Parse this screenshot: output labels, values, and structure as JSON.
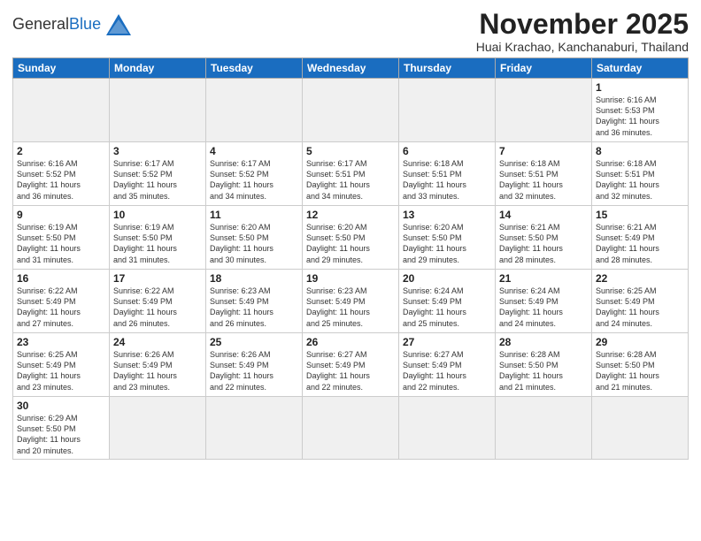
{
  "header": {
    "logo_general": "General",
    "logo_blue": "Blue",
    "month_title": "November 2025",
    "location": "Huai Krachao, Kanchanaburi, Thailand"
  },
  "weekdays": [
    "Sunday",
    "Monday",
    "Tuesday",
    "Wednesday",
    "Thursday",
    "Friday",
    "Saturday"
  ],
  "days": [
    {
      "num": "",
      "info": "",
      "empty": true
    },
    {
      "num": "",
      "info": "",
      "empty": true
    },
    {
      "num": "",
      "info": "",
      "empty": true
    },
    {
      "num": "",
      "info": "",
      "empty": true
    },
    {
      "num": "",
      "info": "",
      "empty": true
    },
    {
      "num": "",
      "info": "",
      "empty": true
    },
    {
      "num": "1",
      "info": "Sunrise: 6:16 AM\nSunset: 5:53 PM\nDaylight: 11 hours\nand 36 minutes."
    },
    {
      "num": "2",
      "info": "Sunrise: 6:16 AM\nSunset: 5:52 PM\nDaylight: 11 hours\nand 36 minutes."
    },
    {
      "num": "3",
      "info": "Sunrise: 6:17 AM\nSunset: 5:52 PM\nDaylight: 11 hours\nand 35 minutes."
    },
    {
      "num": "4",
      "info": "Sunrise: 6:17 AM\nSunset: 5:52 PM\nDaylight: 11 hours\nand 34 minutes."
    },
    {
      "num": "5",
      "info": "Sunrise: 6:17 AM\nSunset: 5:51 PM\nDaylight: 11 hours\nand 34 minutes."
    },
    {
      "num": "6",
      "info": "Sunrise: 6:18 AM\nSunset: 5:51 PM\nDaylight: 11 hours\nand 33 minutes."
    },
    {
      "num": "7",
      "info": "Sunrise: 6:18 AM\nSunset: 5:51 PM\nDaylight: 11 hours\nand 32 minutes."
    },
    {
      "num": "8",
      "info": "Sunrise: 6:18 AM\nSunset: 5:51 PM\nDaylight: 11 hours\nand 32 minutes."
    },
    {
      "num": "9",
      "info": "Sunrise: 6:19 AM\nSunset: 5:50 PM\nDaylight: 11 hours\nand 31 minutes."
    },
    {
      "num": "10",
      "info": "Sunrise: 6:19 AM\nSunset: 5:50 PM\nDaylight: 11 hours\nand 31 minutes."
    },
    {
      "num": "11",
      "info": "Sunrise: 6:20 AM\nSunset: 5:50 PM\nDaylight: 11 hours\nand 30 minutes."
    },
    {
      "num": "12",
      "info": "Sunrise: 6:20 AM\nSunset: 5:50 PM\nDaylight: 11 hours\nand 29 minutes."
    },
    {
      "num": "13",
      "info": "Sunrise: 6:20 AM\nSunset: 5:50 PM\nDaylight: 11 hours\nand 29 minutes."
    },
    {
      "num": "14",
      "info": "Sunrise: 6:21 AM\nSunset: 5:50 PM\nDaylight: 11 hours\nand 28 minutes."
    },
    {
      "num": "15",
      "info": "Sunrise: 6:21 AM\nSunset: 5:49 PM\nDaylight: 11 hours\nand 28 minutes."
    },
    {
      "num": "16",
      "info": "Sunrise: 6:22 AM\nSunset: 5:49 PM\nDaylight: 11 hours\nand 27 minutes."
    },
    {
      "num": "17",
      "info": "Sunrise: 6:22 AM\nSunset: 5:49 PM\nDaylight: 11 hours\nand 26 minutes."
    },
    {
      "num": "18",
      "info": "Sunrise: 6:23 AM\nSunset: 5:49 PM\nDaylight: 11 hours\nand 26 minutes."
    },
    {
      "num": "19",
      "info": "Sunrise: 6:23 AM\nSunset: 5:49 PM\nDaylight: 11 hours\nand 25 minutes."
    },
    {
      "num": "20",
      "info": "Sunrise: 6:24 AM\nSunset: 5:49 PM\nDaylight: 11 hours\nand 25 minutes."
    },
    {
      "num": "21",
      "info": "Sunrise: 6:24 AM\nSunset: 5:49 PM\nDaylight: 11 hours\nand 24 minutes."
    },
    {
      "num": "22",
      "info": "Sunrise: 6:25 AM\nSunset: 5:49 PM\nDaylight: 11 hours\nand 24 minutes."
    },
    {
      "num": "23",
      "info": "Sunrise: 6:25 AM\nSunset: 5:49 PM\nDaylight: 11 hours\nand 23 minutes."
    },
    {
      "num": "24",
      "info": "Sunrise: 6:26 AM\nSunset: 5:49 PM\nDaylight: 11 hours\nand 23 minutes."
    },
    {
      "num": "25",
      "info": "Sunrise: 6:26 AM\nSunset: 5:49 PM\nDaylight: 11 hours\nand 22 minutes."
    },
    {
      "num": "26",
      "info": "Sunrise: 6:27 AM\nSunset: 5:49 PM\nDaylight: 11 hours\nand 22 minutes."
    },
    {
      "num": "27",
      "info": "Sunrise: 6:27 AM\nSunset: 5:49 PM\nDaylight: 11 hours\nand 22 minutes."
    },
    {
      "num": "28",
      "info": "Sunrise: 6:28 AM\nSunset: 5:50 PM\nDaylight: 11 hours\nand 21 minutes."
    },
    {
      "num": "29",
      "info": "Sunrise: 6:28 AM\nSunset: 5:50 PM\nDaylight: 11 hours\nand 21 minutes."
    },
    {
      "num": "30",
      "info": "Sunrise: 6:29 AM\nSunset: 5:50 PM\nDaylight: 11 hours\nand 20 minutes."
    },
    {
      "num": "",
      "info": "",
      "empty": true
    },
    {
      "num": "",
      "info": "",
      "empty": true
    },
    {
      "num": "",
      "info": "",
      "empty": true
    },
    {
      "num": "",
      "info": "",
      "empty": true
    },
    {
      "num": "",
      "info": "",
      "empty": true
    },
    {
      "num": "",
      "info": "",
      "empty": true
    }
  ]
}
